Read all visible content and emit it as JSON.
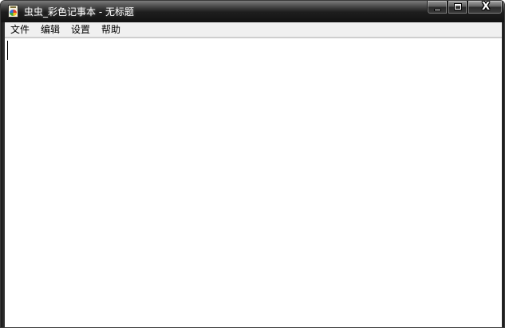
{
  "window": {
    "title": "虫虫_彩色记事本 - 无标题",
    "app_icon": "notepad-color-icon",
    "caption_buttons": {
      "minimize_icon": "minimize-icon",
      "maximize_icon": "maximize-icon",
      "close_label": "X"
    }
  },
  "menubar": {
    "items": [
      {
        "label": "文件"
      },
      {
        "label": "编辑"
      },
      {
        "label": "设置"
      },
      {
        "label": "帮助"
      }
    ]
  },
  "editor": {
    "content": ""
  },
  "colors": {
    "titlebar": "#1e1e1e",
    "menubar": "#f0f0f0",
    "editor_background": "#ffffff",
    "title_text": "#ffffff"
  }
}
